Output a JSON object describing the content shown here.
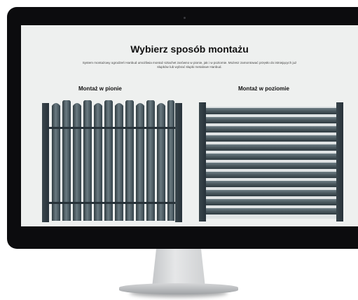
{
  "page": {
    "title": "Wybierz sposób montażu",
    "description": "System montażowy ogrodzeń Hanbud umożliwia montaż sztachet zarówno w pionie, jak i w poziomie. Możesz zamontować przęsło do istniejących już słupków lub wybrać słupki metalowe Hanbud."
  },
  "options": [
    {
      "label": "Montaż w pionie",
      "image": "vertical-fence"
    },
    {
      "label": "Montaż w poziomie",
      "image": "horizontal-fence"
    }
  ],
  "colors": {
    "bezel": "#0c0c0e",
    "screen_bg": "#eef0ef",
    "fence_dark": "#3f4c52",
    "fence_light": "#6b7b82"
  }
}
